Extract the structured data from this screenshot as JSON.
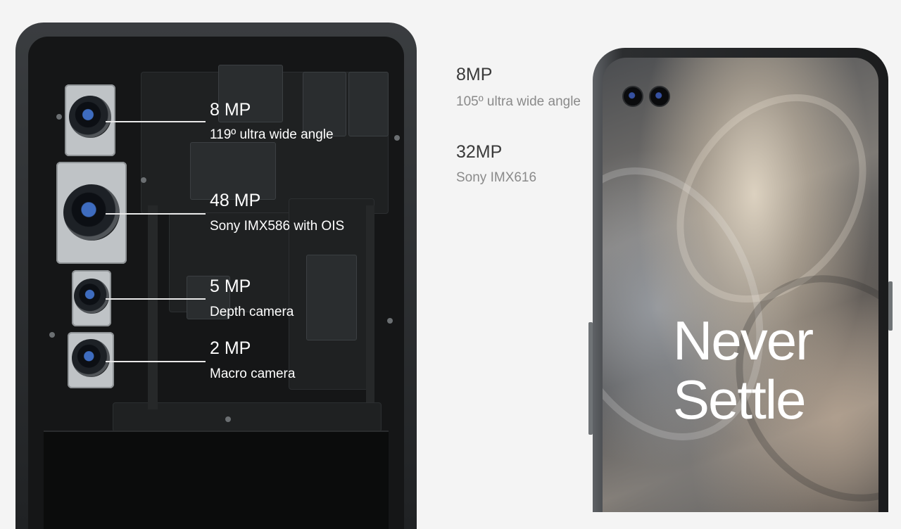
{
  "rear_cameras": [
    {
      "title": "8 MP",
      "subtitle": "119º ultra wide angle"
    },
    {
      "title": "48 MP",
      "subtitle": "Sony IMX586 with OIS"
    },
    {
      "title": "5 MP",
      "subtitle": "Depth camera"
    },
    {
      "title": "2 MP",
      "subtitle": "Macro camera"
    }
  ],
  "front_cameras": [
    {
      "title": "8MP",
      "subtitle": "105º ultra wide angle"
    },
    {
      "title": "32MP",
      "subtitle": "Sony IMX616"
    }
  ],
  "wallpaper_text": {
    "line1": "Never",
    "line2": "Settle"
  },
  "colors": {
    "background": "#f4f4f4",
    "phone_body": "#202224",
    "label_white": "#ffffff",
    "spec_dark": "#3a3a3a",
    "spec_grey": "#8a8a8a"
  }
}
